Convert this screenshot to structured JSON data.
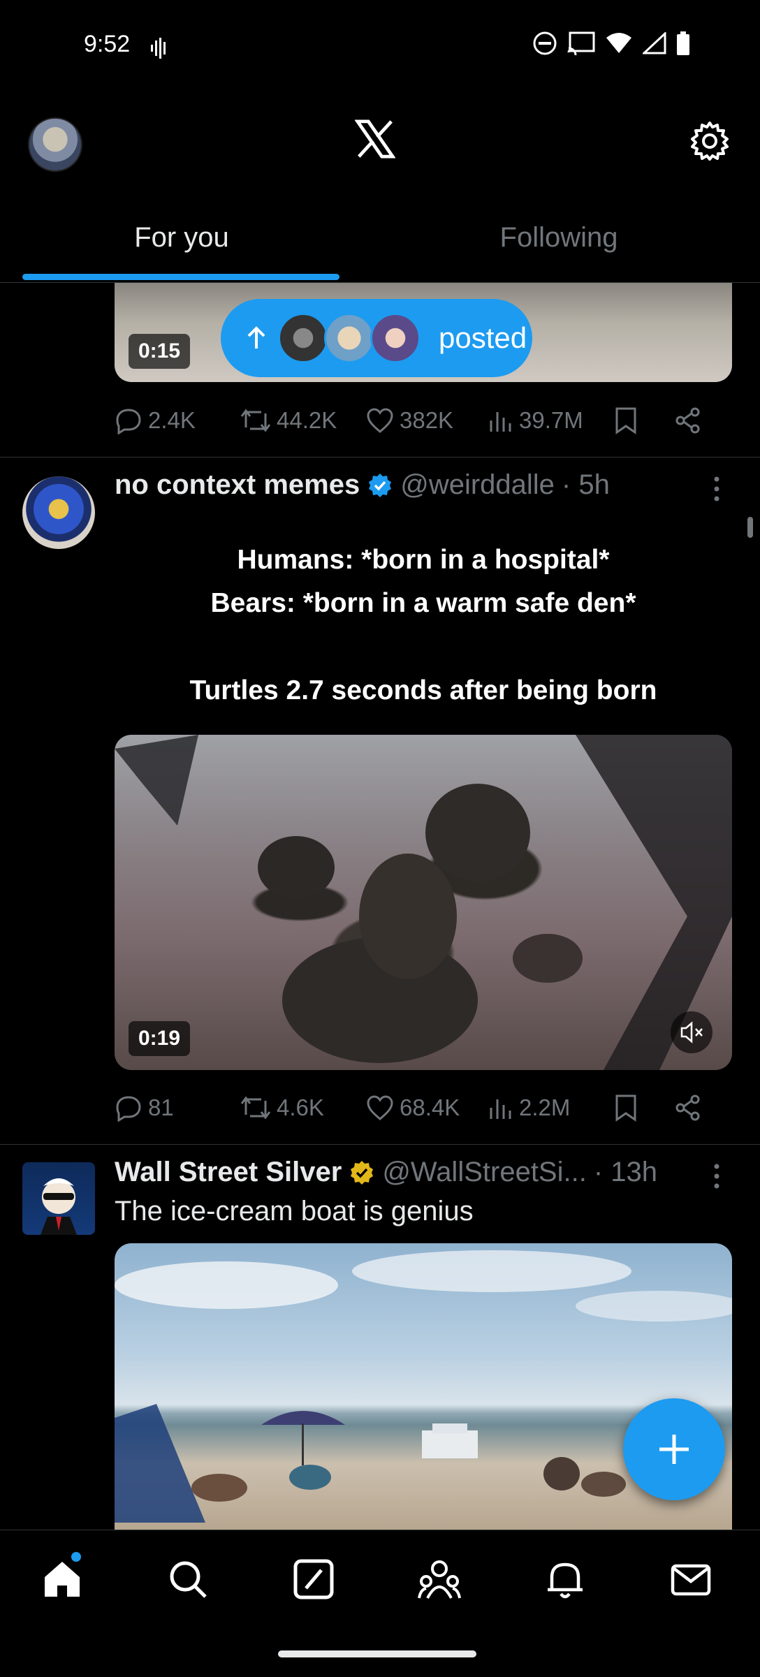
{
  "status_bar": {
    "time": "9:52"
  },
  "header": {
    "x_logo": "X"
  },
  "tabs": [
    {
      "label": "For you",
      "active": true
    },
    {
      "label": "Following",
      "active": false
    }
  ],
  "previous_tweet": {
    "video_duration": "0:15",
    "posted_label": "posted",
    "stats": {
      "replies": "2.4K",
      "reposts": "44.2K",
      "likes": "382K",
      "views": "39.7M"
    }
  },
  "tweet1": {
    "name": "no context memes",
    "handle": "@weirddalle",
    "time": "· 5h",
    "lines": [
      "Humans: *born in a hospital*",
      "Bears: *born in a warm safe den*",
      "Turtles 2.7 seconds after being born"
    ],
    "video_duration": "0:19",
    "stats": {
      "replies": "81",
      "reposts": "4.6K",
      "likes": "68.4K",
      "views": "2.2M"
    }
  },
  "tweet2": {
    "name": "Wall Street Silver",
    "handle": "@WallStreetSi...",
    "time": "· 13h",
    "text": "The ice-cream boat is genius"
  },
  "colors": {
    "accent": "#1d9bf0",
    "verified_blue": "#1d9bf0",
    "verified_gold": "#e2b719",
    "muted": "#71767b"
  },
  "icons": [
    "signal-icon",
    "dnd-icon",
    "cast-icon",
    "wifi-icon",
    "cell-icon",
    "battery-icon",
    "gear-icon",
    "x-logo-icon",
    "reply-icon",
    "repost-icon",
    "like-icon",
    "views-icon",
    "bookmark-icon",
    "share-icon",
    "more-icon",
    "mute-icon",
    "compose-plus-icon",
    "home-icon",
    "search-icon",
    "grok-icon",
    "communities-icon",
    "notifications-icon",
    "messages-icon"
  ]
}
